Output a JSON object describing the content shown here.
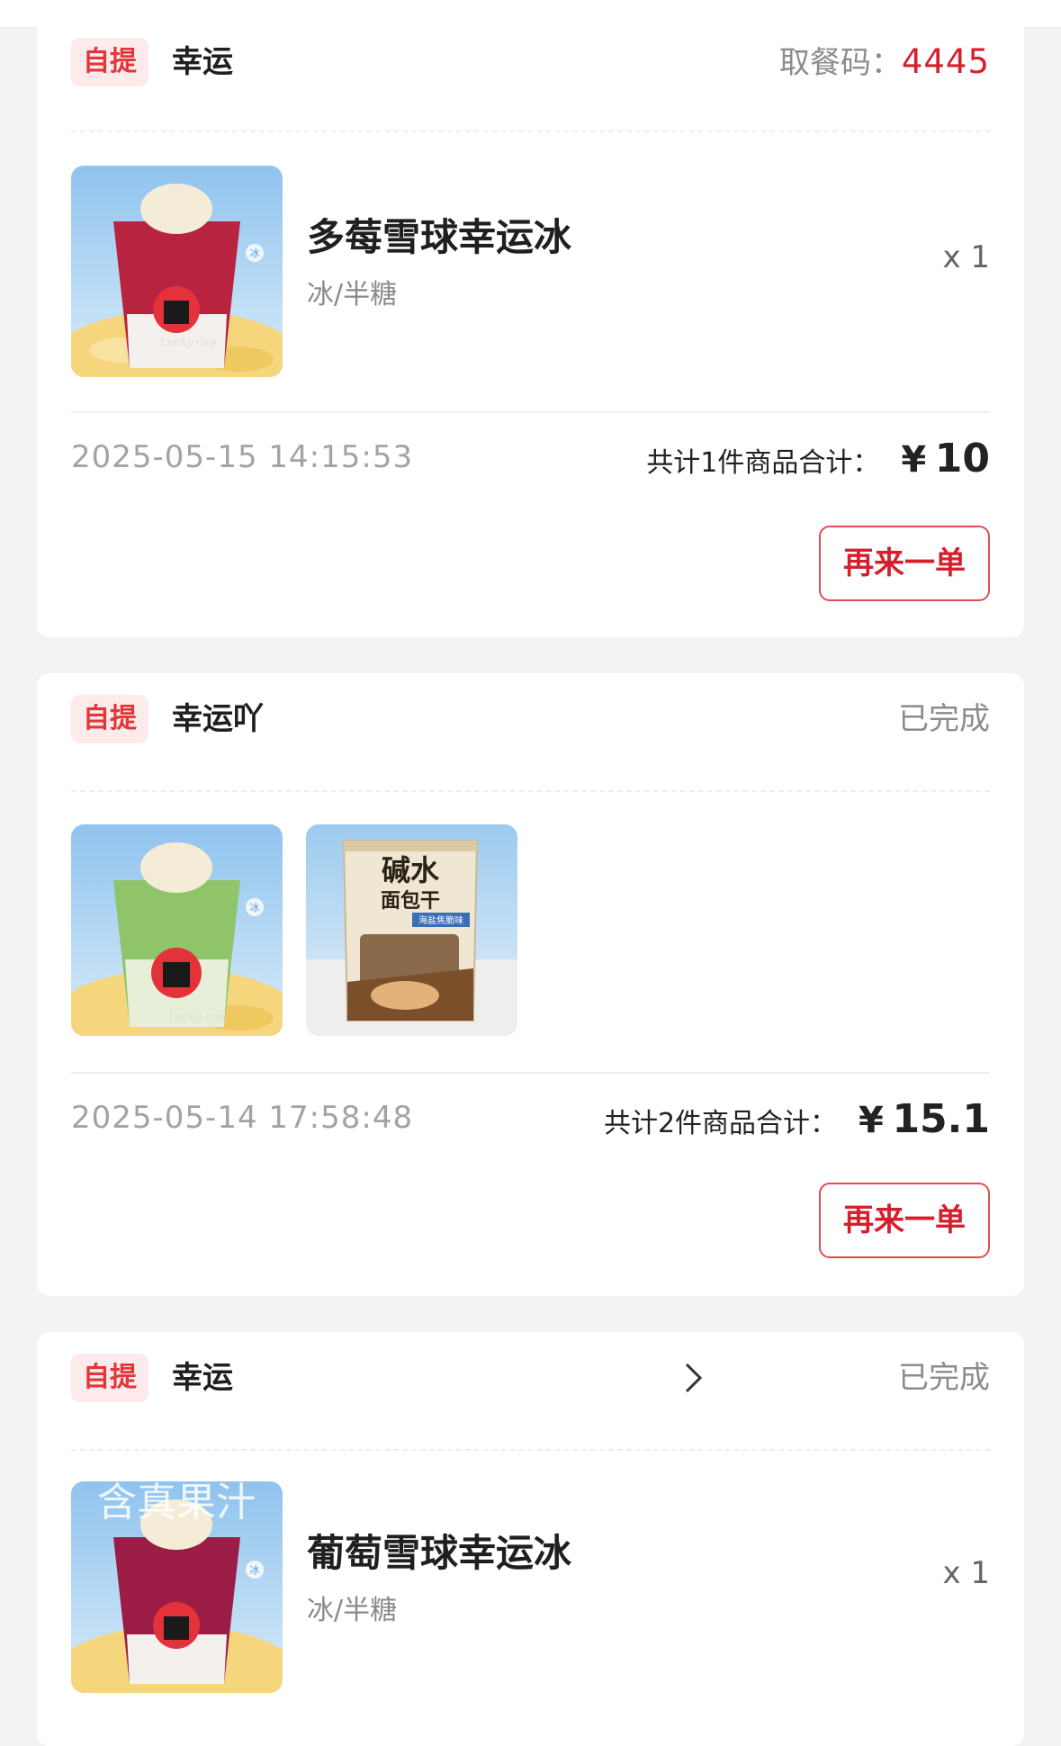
{
  "orders": [
    {
      "tag": "自提",
      "store": "幸运",
      "status_label": "取餐码：",
      "pickup_code": "4445",
      "item": {
        "name": "多莓雪球幸运冰",
        "spec": "冰/半糖",
        "qty": "x 1",
        "drink_color": "#b8233f"
      },
      "time": "2025-05-15 14:15:53",
      "summary": "共计1件商品合计：",
      "currency": "¥",
      "amount": "10",
      "reorder": "再来一单"
    },
    {
      "tag": "自提",
      "store": "幸运吖",
      "status": "已完成",
      "items": [
        {
          "kind": "drink",
          "drink_color": "#8fc46a"
        },
        {
          "kind": "snack",
          "label_line1": "碱水",
          "label_line2": "面包干",
          "badge": "海盐焦脆味"
        }
      ],
      "time": "2025-05-14 17:58:48",
      "summary": "共计2件商品合计：",
      "currency": "¥",
      "amount": "15.1",
      "reorder": "再来一单"
    },
    {
      "tag": "自提",
      "store": "幸运",
      "status": "已完成",
      "item": {
        "name": "葡萄雪球幸运冰",
        "spec": "冰/半糖",
        "qty": "x 1",
        "overlay": "含真果汁",
        "drink_color": "#9b1c45"
      }
    }
  ],
  "cup_badge": "冰",
  "cup_script": "Lucky cup"
}
